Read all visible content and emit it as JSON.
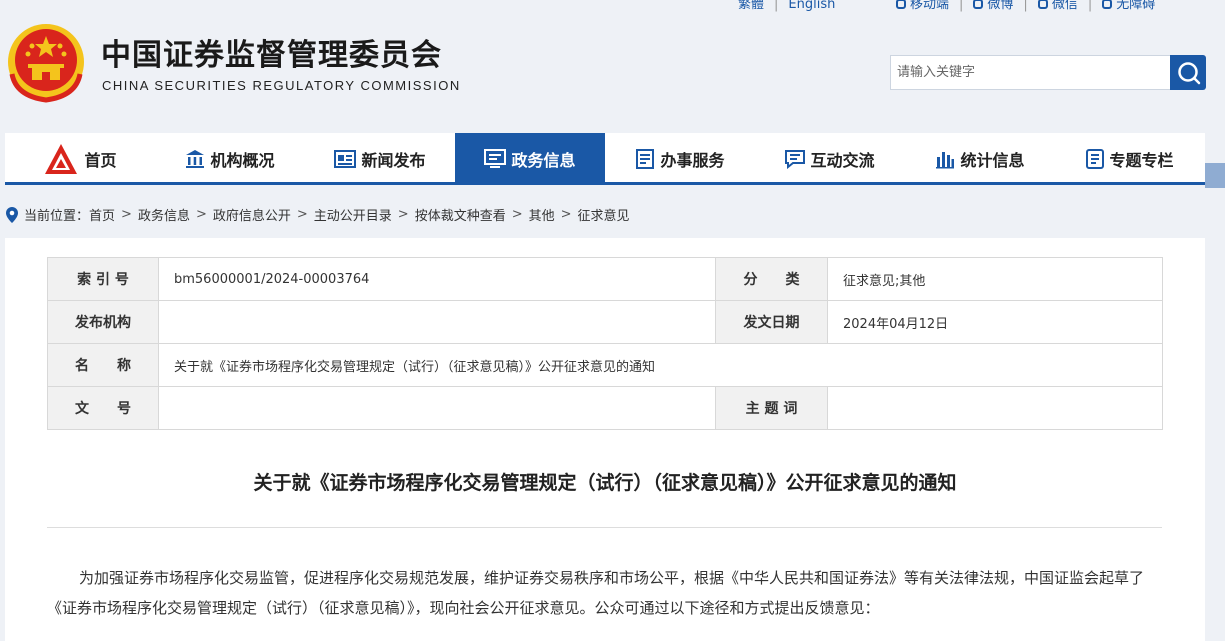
{
  "topbar": {
    "left_links": [
      "繁體",
      "English"
    ],
    "right_links": [
      "移动端",
      "微博",
      "微信",
      "无障碍"
    ]
  },
  "header": {
    "title": "中国证券监督管理委员会",
    "subtitle": "CHINA SECURITIES REGULATORY COMMISSION"
  },
  "search": {
    "placeholder": "请输入关键字"
  },
  "nav": {
    "items": [
      {
        "label": "首页",
        "icon": "logo-icon"
      },
      {
        "label": "机构概况",
        "icon": "building-icon"
      },
      {
        "label": "新闻发布",
        "icon": "news-icon"
      },
      {
        "label": "政务信息",
        "icon": "info-icon",
        "active": true
      },
      {
        "label": "办事服务",
        "icon": "service-icon"
      },
      {
        "label": "互动交流",
        "icon": "chat-icon"
      },
      {
        "label": "统计信息",
        "icon": "chart-icon"
      },
      {
        "label": "专题专栏",
        "icon": "topic-icon"
      }
    ]
  },
  "breadcrumb": {
    "prefix": "当前位置：",
    "items": [
      "首页",
      "政务信息",
      "政府信息公开",
      "主动公开目录",
      "按体裁文种查看",
      "其他",
      "征求意见"
    ]
  },
  "meta": {
    "index_label": "索 引 号",
    "index_value": "bm56000001/2024-00003764",
    "category_label": "分　　类",
    "category_value": "征求意见;其他",
    "publisher_label": "发布机构",
    "publisher_value": "",
    "date_label": "发文日期",
    "date_value": "2024年04月12日",
    "name_label": "名　　称",
    "name_value": "关于就《证券市场程序化交易管理规定（试行）（征求意见稿）》公开征求意见的通知",
    "docno_label": "文　　号",
    "docno_value": "",
    "keywords_label": "主 题 词",
    "keywords_value": ""
  },
  "article": {
    "title": "关于就《证券市场程序化交易管理规定（试行）（征求意见稿）》公开征求意见的通知",
    "paragraph": "为加强证券市场程序化交易监管，促进程序化交易规范发展，维护证券交易秩序和市场公平，根据《中华人民共和国证券法》等有关法律法规，中国证监会起草了《证券市场程序化交易管理规定（试行）（征求意见稿）》，现向社会公开征求意见。公众可通过以下途径和方式提出反馈意见："
  },
  "colors": {
    "brand_blue": "#1a58a6",
    "emblem_red": "#d9251c",
    "emblem_gold": "#f4c41c"
  }
}
